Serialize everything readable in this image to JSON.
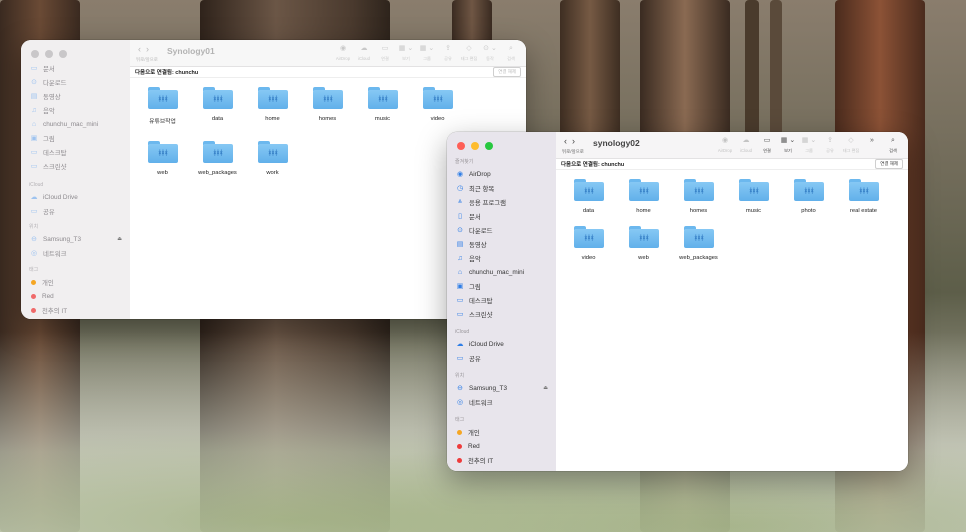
{
  "win1": {
    "title": "Synology01",
    "nav_label": "뒤로/앞으로",
    "connection": "다음으로 연결됨: chunchu",
    "disconnect": "연결 해제",
    "sidebar": {
      "items_top": [
        {
          "icon": "▭",
          "label": "문서"
        },
        {
          "icon": "⊙",
          "label": "다운로드"
        },
        {
          "icon": "▤",
          "label": "동영상"
        },
        {
          "icon": "♫",
          "label": "음악"
        },
        {
          "icon": "⌂",
          "label": "chunchu_mac_mini"
        },
        {
          "icon": "▣",
          "label": "그림"
        },
        {
          "icon": "▭",
          "label": "데스크탑"
        },
        {
          "icon": "▭",
          "label": "스크린샷"
        }
      ],
      "icloud_head": "iCloud",
      "icloud_items": [
        {
          "icon": "☁",
          "label": "iCloud Drive"
        },
        {
          "icon": "▭",
          "label": "공유"
        }
      ],
      "locations_head": "위치",
      "location_items": [
        {
          "icon": "⊖",
          "label": "Samsung_T3"
        },
        {
          "icon": "◎",
          "label": "네트워크"
        }
      ],
      "tags_head": "태그",
      "tags": [
        {
          "label": "개인",
          "color": "#f5a623"
        },
        {
          "label": "Red",
          "color": "#f06a6a"
        },
        {
          "label": "천추의 IT",
          "color": "#f06a6a"
        }
      ]
    },
    "toolbar": [
      {
        "icon": "◉",
        "label": "AirDrop"
      },
      {
        "icon": "☁",
        "label": "iCloud"
      },
      {
        "icon": "▭",
        "label": "연결"
      },
      {
        "icon": "▦ ⌄",
        "label": "보기"
      },
      {
        "icon": "▦ ⌄",
        "label": "그룹"
      },
      {
        "icon": "⇪",
        "label": "공유"
      },
      {
        "icon": "◇",
        "label": "태그 편집"
      },
      {
        "icon": "⊙ ⌄",
        "label": "동작"
      },
      {
        "icon": "⌕",
        "label": "검색"
      }
    ],
    "folders": [
      "유튜브작업",
      "data",
      "home",
      "homes",
      "music",
      "video",
      "web",
      "web_packages",
      "work"
    ]
  },
  "win2": {
    "title": "synology02",
    "nav_label": "뒤로/앞으로",
    "connection": "다음으로 연결됨: chunchu",
    "disconnect": "연결 해제",
    "sidebar": {
      "favorites_head": "즐겨찾기",
      "items_top": [
        {
          "icon": "◉",
          "label": "AirDrop"
        },
        {
          "icon": "◷",
          "label": "최근 항목"
        },
        {
          "icon": "⩓",
          "label": "응용 프로그램"
        },
        {
          "icon": "▯",
          "label": "문서"
        },
        {
          "icon": "⊙",
          "label": "다운로드"
        },
        {
          "icon": "▤",
          "label": "동영상"
        },
        {
          "icon": "♫",
          "label": "음악"
        },
        {
          "icon": "⌂",
          "label": "chunchu_mac_mini"
        },
        {
          "icon": "▣",
          "label": "그림"
        },
        {
          "icon": "▭",
          "label": "데스크탑"
        },
        {
          "icon": "▭",
          "label": "스크린샷"
        }
      ],
      "icloud_head": "iCloud",
      "icloud_items": [
        {
          "icon": "☁",
          "label": "iCloud Drive"
        },
        {
          "icon": "▭",
          "label": "공유"
        }
      ],
      "locations_head": "위치",
      "location_items": [
        {
          "icon": "⊖",
          "label": "Samsung_T3"
        },
        {
          "icon": "◎",
          "label": "네트워크"
        }
      ],
      "tags_head": "태그",
      "tags": [
        {
          "label": "개인",
          "color": "#f5a623"
        },
        {
          "label": "Red",
          "color": "#ee3b3b"
        },
        {
          "label": "천추의 IT",
          "color": "#ee3b3b"
        }
      ]
    },
    "toolbar": [
      {
        "icon": "◉",
        "label": "AirDrop",
        "state": "dim"
      },
      {
        "icon": "☁",
        "label": "iCloud",
        "state": "dim"
      },
      {
        "icon": "▭",
        "label": "연결",
        "state": "strong"
      },
      {
        "icon": "▦ ⌄",
        "label": "보기",
        "state": "strong"
      },
      {
        "icon": "▦ ⌄",
        "label": "그룹",
        "state": "dim"
      },
      {
        "icon": "⇪",
        "label": "공유",
        "state": "dim"
      },
      {
        "icon": "◇",
        "label": "태그 편집",
        "state": "dim"
      },
      {
        "icon": "»",
        "label": "",
        "state": "strong"
      },
      {
        "icon": "⌕",
        "label": "검색",
        "state": "strong"
      }
    ],
    "folders": [
      "data",
      "home",
      "homes",
      "music",
      "photo",
      "real estate",
      "video",
      "web",
      "web_packages"
    ]
  }
}
